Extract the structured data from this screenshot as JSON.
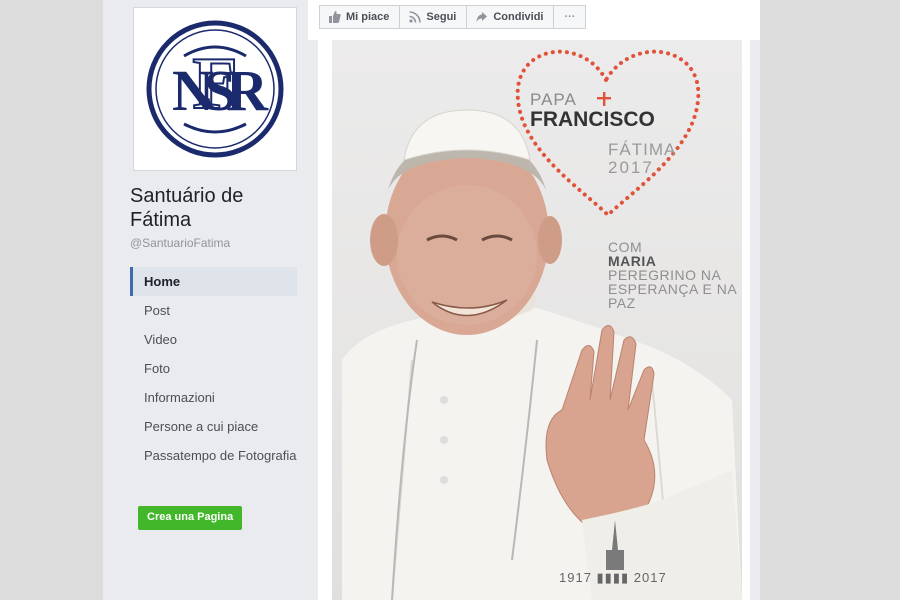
{
  "page": {
    "name": "Santuário de Fátima",
    "handle": "@SantuarioFatima",
    "logo_monogram": "SNF"
  },
  "nav": {
    "items": [
      {
        "label": "Home",
        "active": true
      },
      {
        "label": "Post"
      },
      {
        "label": "Video"
      },
      {
        "label": "Foto"
      },
      {
        "label": "Informazioni"
      },
      {
        "label": "Persone a cui piace"
      },
      {
        "label": "Passatempo de Fotografia"
      }
    ],
    "create_label": "Crea una Pagina"
  },
  "actions": {
    "like": "Mi piace",
    "follow": "Segui",
    "share": "Condividi",
    "more": "···"
  },
  "cover": {
    "papa": "PAPA",
    "francisco": "FRANCISCO",
    "fatima": "FÁTIMA",
    "year": "2017",
    "motto_com": "COM",
    "motto_maria": "MARIA",
    "motto_rest": "PEREGRINO NA ESPERANÇA E NA PAZ",
    "anniversary": "1917 ▮▮▮▮ 2017"
  },
  "colors": {
    "accent_blue": "#4267b2",
    "create_green": "#42b72a",
    "heart_red": "#e0533a",
    "logo_navy": "#1a2a6c"
  }
}
